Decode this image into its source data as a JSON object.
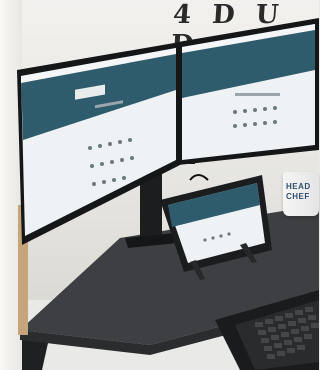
{
  "scene": {
    "wall_art_text": "4 D U D",
    "mug_lines": [
      "HEAD",
      "CHEF"
    ],
    "colors": {
      "desk_top": "#3c3e40",
      "monitor_frame": "#151617",
      "screen_header": "#2f5c6c",
      "screen_body": "#eef2f4"
    }
  }
}
